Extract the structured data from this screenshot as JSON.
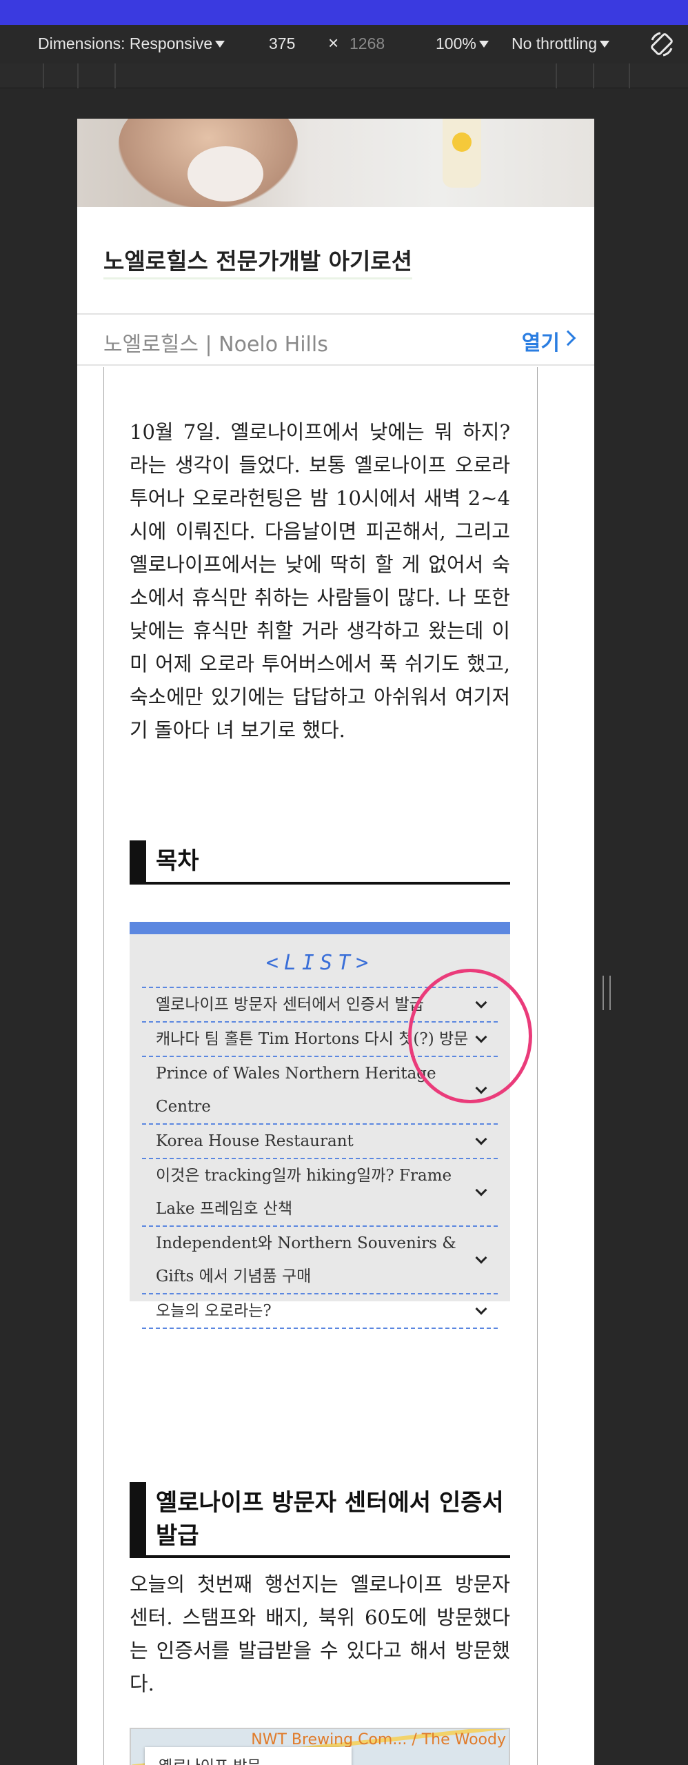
{
  "devtools": {
    "dimensions_label": "Dimensions: Responsive",
    "width_value": "375",
    "times_sign": "×",
    "height_value": "1268",
    "zoom": "100%",
    "throttling": "No throttling",
    "rotate_icon": "rotate-icon"
  },
  "ad": {
    "title": "노엘로힐스 전문가개발 아기로션",
    "brand": "노엘로힐스 | Noelo Hills",
    "open_label": "열기"
  },
  "article": {
    "intro": "10월 7일. 옐로나이프에서 낮에는 뭐 하지? 라는 생각이 들었다. 보통 옐로나이프 오로라투어나 오로라헌팅은 밤 10시에서 새벽 2~4시에 이뤄진다. 다음날이면 피곤해서, 그리고 옐로나이프에서는 낮에 딱히 할 게 없어서 숙소에서 휴식만 취하는 사람들이 많다. 나 또한 낮에는 휴식만 취할 거라 생각하고 왔는데 이미 어제 오로라 투어버스에서 푹 쉬기도 했고, 숙소에만 있기에는 답답하고 아쉬워서 여기저기 돌아다 녀 보기로 했다.",
    "toc_heading": "목차",
    "toc_list_title": "<LIST>",
    "toc_items": [
      "옐로나이프 방문자 센터에서 인증서 발급",
      "캐나다 팀 홀튼 Tim Hortons 다시 첫(?) 방문",
      "Prince of Wales Northern Heritage Centre",
      "Korea House Restaurant",
      "이것은 tracking일까 hiking일까? Frame Lake 프레임호 산책",
      "Independent와 Northern Souvenirs & Gifts 에서 기념품 구매",
      "오늘의 오로라는?"
    ],
    "section1_heading": "옐로나이프 방문자 센터에서 인증서 발급",
    "section1_text": "오늘의 첫번째 행선지는 옐로나이프 방문자 센터. 스탬프와 배지, 북위 60도에 방문했다는 인증서를 발급받을 수 있다고 해서 방문했다.",
    "map_card": "옐로나이프 방문...",
    "map_label": "NWT Brewing Com... / The Woody"
  },
  "side_tools": [
    "pencil-icon",
    "gear-icon",
    "bookmark-icon",
    "menu-icon",
    "double-chevron-up-icon"
  ],
  "colors": {
    "accent_blue": "#5b87e0",
    "link_blue": "#2a7de1",
    "annotation_pink": "#ea3b7a",
    "devtools_bg": "#292929"
  }
}
